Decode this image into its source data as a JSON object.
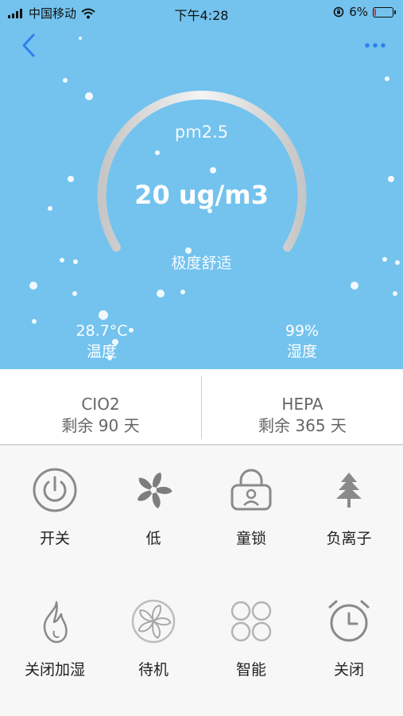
{
  "status_bar": {
    "carrier": "中国移动",
    "time": "下午4:28",
    "battery_percent": "6%",
    "battery_level": 0.06,
    "battery_color": "#d33333"
  },
  "header": {
    "back_icon": "chevron-left-icon",
    "more_icon": "more-dots-icon",
    "accent_color": "#2f7ff2"
  },
  "air": {
    "label": "pm2.5",
    "value": "20 ug/m3",
    "status": "极度舒适"
  },
  "environment": {
    "temperature": "28.7°C",
    "temperature_label": "温度",
    "humidity": "99%",
    "humidity_label": "湿度"
  },
  "filters": [
    {
      "name": "CIO2",
      "remaining": "剩余 90 天"
    },
    {
      "name": "HEPA",
      "remaining": "剩余 365 天"
    }
  ],
  "controls": [
    {
      "label": "开关",
      "icon": "power-icon"
    },
    {
      "label": "低",
      "icon": "fan-icon"
    },
    {
      "label": "童锁",
      "icon": "child-lock-icon"
    },
    {
      "label": "负离子",
      "icon": "tree-icon"
    },
    {
      "label": "关闭加湿",
      "icon": "flame-icon"
    },
    {
      "label": "待机",
      "icon": "standby-fan-icon"
    },
    {
      "label": "智能",
      "icon": "smart-circles-icon"
    },
    {
      "label": "关闭",
      "icon": "alarm-clock-icon"
    }
  ],
  "colors": {
    "hero_background": "#73c3ee",
    "icon_gray": "#8a8a8a"
  }
}
